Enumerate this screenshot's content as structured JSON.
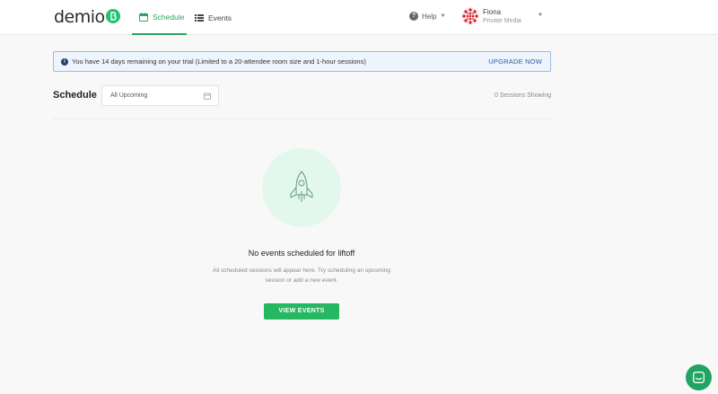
{
  "brand": {
    "name": "demio",
    "accent": "#26c06f"
  },
  "nav": {
    "tabs": [
      {
        "label": "Schedule",
        "icon": "calendar-icon",
        "active": true
      },
      {
        "label": "Events",
        "icon": "list-icon",
        "active": false
      }
    ]
  },
  "header": {
    "help_label": "Help",
    "user": {
      "name": "Fiona",
      "org": "Private Media"
    }
  },
  "banner": {
    "text": "You have 14 days remaining on your trial (Limited to a 20-attendee room size and 1-hour sessions)",
    "action": "UPGRADE NOW"
  },
  "schedule": {
    "title": "Schedule",
    "filter_value": "All Upcoming",
    "sessions_showing": "0 Sessions Showing"
  },
  "empty_state": {
    "icon": "rocket-icon",
    "title": "No events scheduled for liftoff",
    "description": "All scheduled sessions will appear here. Try scheduling an upcoming session or add a new event.",
    "button": "VIEW EVENTS"
  },
  "colors": {
    "primary": "#26b861",
    "banner_bg": "#eef4fc",
    "banner_border": "#9dbbe6",
    "link": "#2b5fa6"
  }
}
